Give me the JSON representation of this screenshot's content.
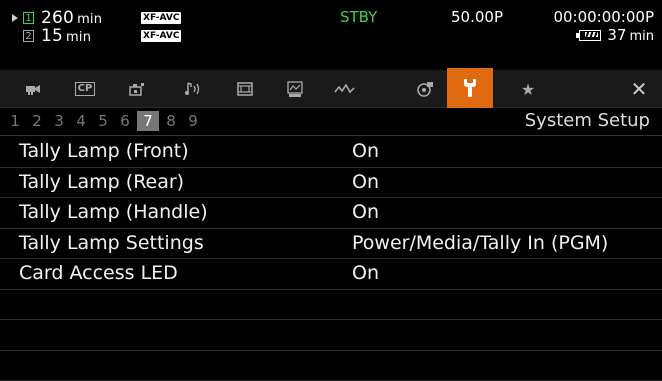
{
  "status": {
    "media": [
      {
        "card_num": "1",
        "time": "260",
        "unit": "min",
        "format": "XF-AVC"
      },
      {
        "card_num": "2",
        "time": "15",
        "unit": "min",
        "format": "XF-AVC"
      }
    ],
    "mode": "STBY",
    "frame_rate": "50.00P",
    "timecode": "00:00:00:00P",
    "battery": {
      "value": "37",
      "unit": "min"
    }
  },
  "tabs": [
    {
      "icon": "camera-icon"
    },
    {
      "icon": "custom-picture-icon",
      "label": "CP"
    },
    {
      "icon": "camera-setup-icon"
    },
    {
      "icon": "audio-icon"
    },
    {
      "icon": "film-frame-icon"
    },
    {
      "icon": "playback-icon"
    },
    {
      "icon": "waveform-icon"
    },
    {
      "icon": "recording-media-icon"
    },
    {
      "icon": "wrench-icon",
      "active": true
    },
    {
      "icon": "star-icon",
      "glyph": "★"
    },
    {
      "icon": "close-icon",
      "glyph": "✕"
    }
  ],
  "pages": [
    "1",
    "2",
    "3",
    "4",
    "5",
    "6",
    "7",
    "8",
    "9"
  ],
  "active_page": "7",
  "section_title": "System Setup",
  "settings": [
    {
      "label": "Tally Lamp (Front)",
      "value": "On"
    },
    {
      "label": "Tally Lamp (Rear)",
      "value": "On"
    },
    {
      "label": "Tally Lamp (Handle)",
      "value": "On"
    },
    {
      "label": "Tally Lamp Settings",
      "value": "Power/Media/Tally In (PGM)"
    },
    {
      "label": "Card Access LED",
      "value": "On"
    },
    {
      "label": "",
      "value": ""
    },
    {
      "label": "",
      "value": ""
    },
    {
      "label": "",
      "value": ""
    }
  ],
  "colors": {
    "accent": "#e06a10",
    "standby": "#3fd24a"
  }
}
